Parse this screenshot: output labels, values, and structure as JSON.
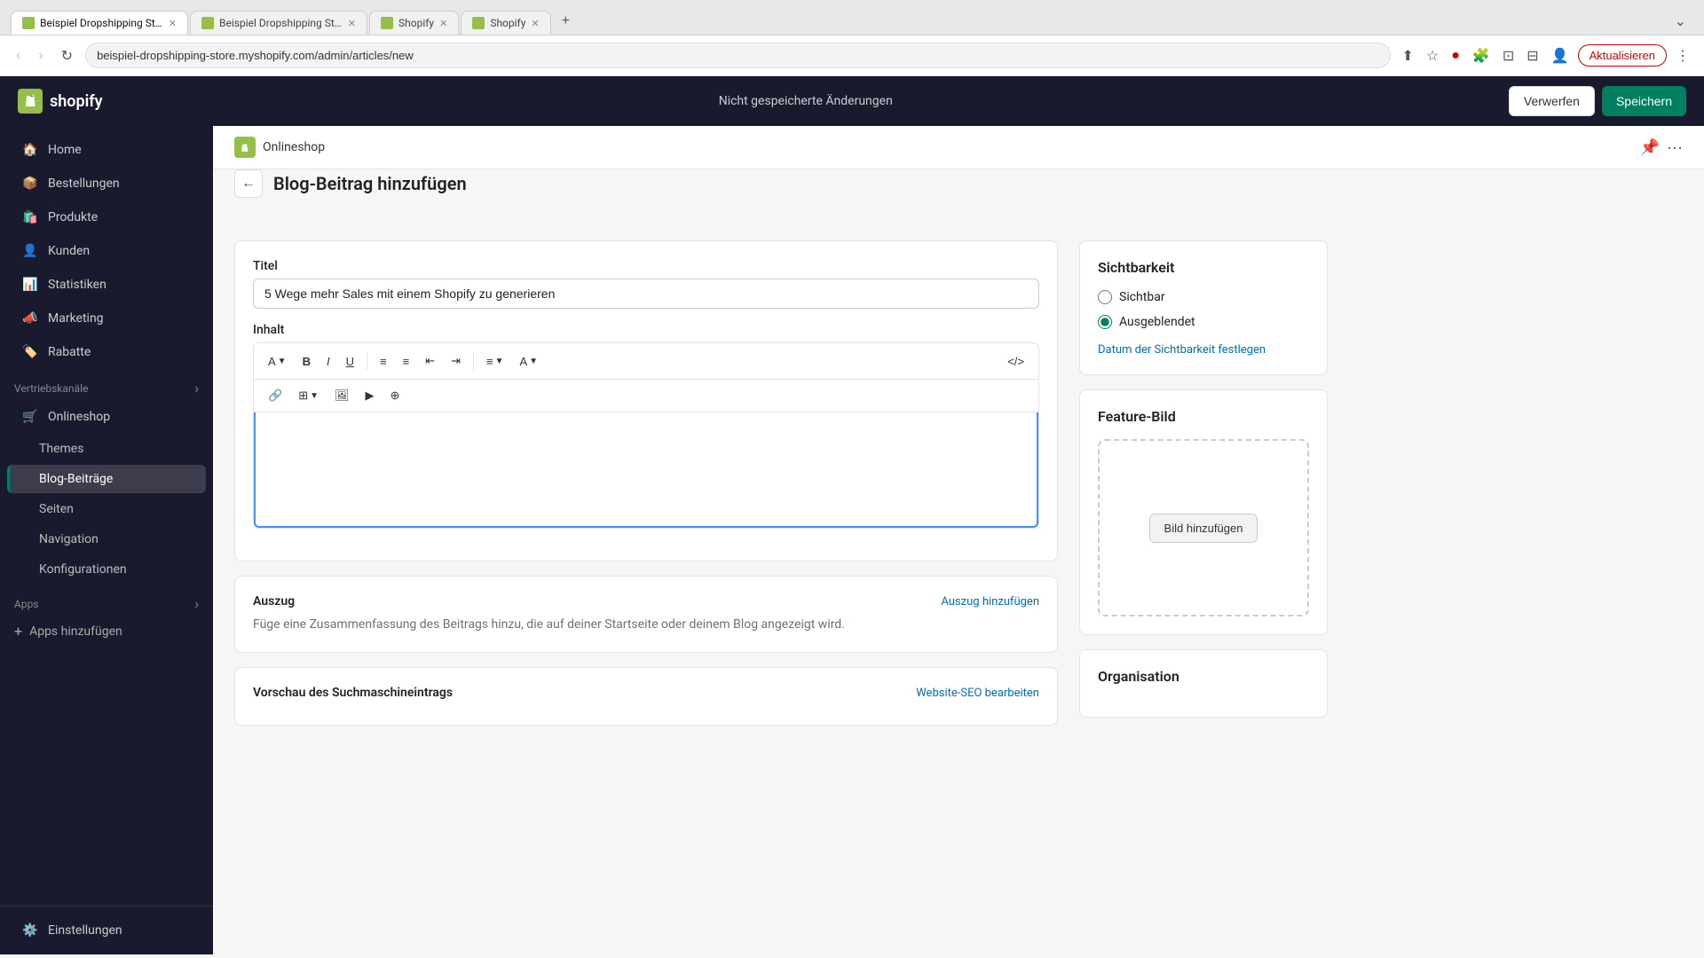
{
  "browser": {
    "tabs": [
      {
        "id": "tab1",
        "label": "Beispiel Dropshipping Store -...",
        "favicon_color": "#95bf47",
        "active": true
      },
      {
        "id": "tab2",
        "label": "Beispiel Dropshipping Store",
        "favicon_color": "#95bf47",
        "active": false
      },
      {
        "id": "tab3",
        "label": "Shopify",
        "favicon_color": "#95bf47",
        "active": false
      },
      {
        "id": "tab4",
        "label": "Shopify",
        "favicon_color": "#95bf47",
        "active": false
      }
    ],
    "address": "beispiel-dropshipping-store.myshopify.com/admin/articles/new",
    "update_btn": "Aktualisieren"
  },
  "header": {
    "logo": "shopify",
    "unsaved_message": "Nicht gespeicherte Änderungen",
    "discard_btn": "Verwerfen",
    "save_btn": "Speichern"
  },
  "sidebar": {
    "items": [
      {
        "id": "home",
        "label": "Home",
        "icon": "🏠"
      },
      {
        "id": "orders",
        "label": "Bestellungen",
        "icon": "📦"
      },
      {
        "id": "products",
        "label": "Produkte",
        "icon": "🛍️"
      },
      {
        "id": "customers",
        "label": "Kunden",
        "icon": "👤"
      },
      {
        "id": "analytics",
        "label": "Statistiken",
        "icon": "📊"
      },
      {
        "id": "marketing",
        "label": "Marketing",
        "icon": "📣"
      },
      {
        "id": "discounts",
        "label": "Rabatte",
        "icon": "🏷️"
      }
    ],
    "section_vertrieb": "Vertriebskanäle",
    "section_apps": "Apps",
    "online_shop": "Onlineshop",
    "sub_items": [
      {
        "id": "themes",
        "label": "Themes",
        "active": false
      },
      {
        "id": "blog-posts",
        "label": "Blog-Beiträge",
        "active": true
      },
      {
        "id": "pages",
        "label": "Seiten",
        "active": false
      },
      {
        "id": "navigation",
        "label": "Navigation",
        "active": false
      },
      {
        "id": "configuration",
        "label": "Konfigurationen",
        "active": false
      }
    ],
    "add_apps_label": "Apps hinzufügen",
    "settings_label": "Einstellungen"
  },
  "sub_header": {
    "breadcrumb": "Onlineshop",
    "pin_icon": "📌",
    "more_icon": "···"
  },
  "page": {
    "back_icon": "←",
    "title": "Blog-Beitrag hinzufügen",
    "title_label": "Titel",
    "title_value": "5 Wege mehr Sales mit einem Shopify zu generieren",
    "content_label": "Inhalt",
    "toolbar": {
      "text_btn": "A",
      "bold_btn": "B",
      "italic_btn": "I",
      "underline_btn": "U",
      "list_unordered": "≡",
      "list_center": "≡",
      "indent_decrease": "⇤",
      "indent_increase": "⇥",
      "align_btn": "≡",
      "color_btn": "A",
      "code_btn": "</>",
      "link_btn": "🔗",
      "table_btn": "⊞",
      "image_btn": "🖼",
      "video_btn": "▶",
      "more_btn": "⊕"
    },
    "excerpt_title": "Auszug",
    "excerpt_add_link": "Auszug hinzufügen",
    "excerpt_text": "Füge eine Zusammenfassung des Beitrags hinzu, die auf deiner Startseite oder deinem Blog angezeigt wird.",
    "seo_title": "Vorschau des Suchmaschineintrags",
    "seo_edit_link": "Website-SEO bearbeiten"
  },
  "right_panel": {
    "visibility_title": "Sichtbarkeit",
    "visibility_options": [
      {
        "id": "visible",
        "label": "Sichtbar",
        "checked": false
      },
      {
        "id": "hidden",
        "label": "Ausgeblendet",
        "checked": true
      }
    ],
    "schedule_link": "Datum der Sichtbarkeit festlegen",
    "feature_image_title": "Feature-Bild",
    "feature_image_btn": "Bild hinzufügen",
    "organisation_title": "Organisation"
  }
}
